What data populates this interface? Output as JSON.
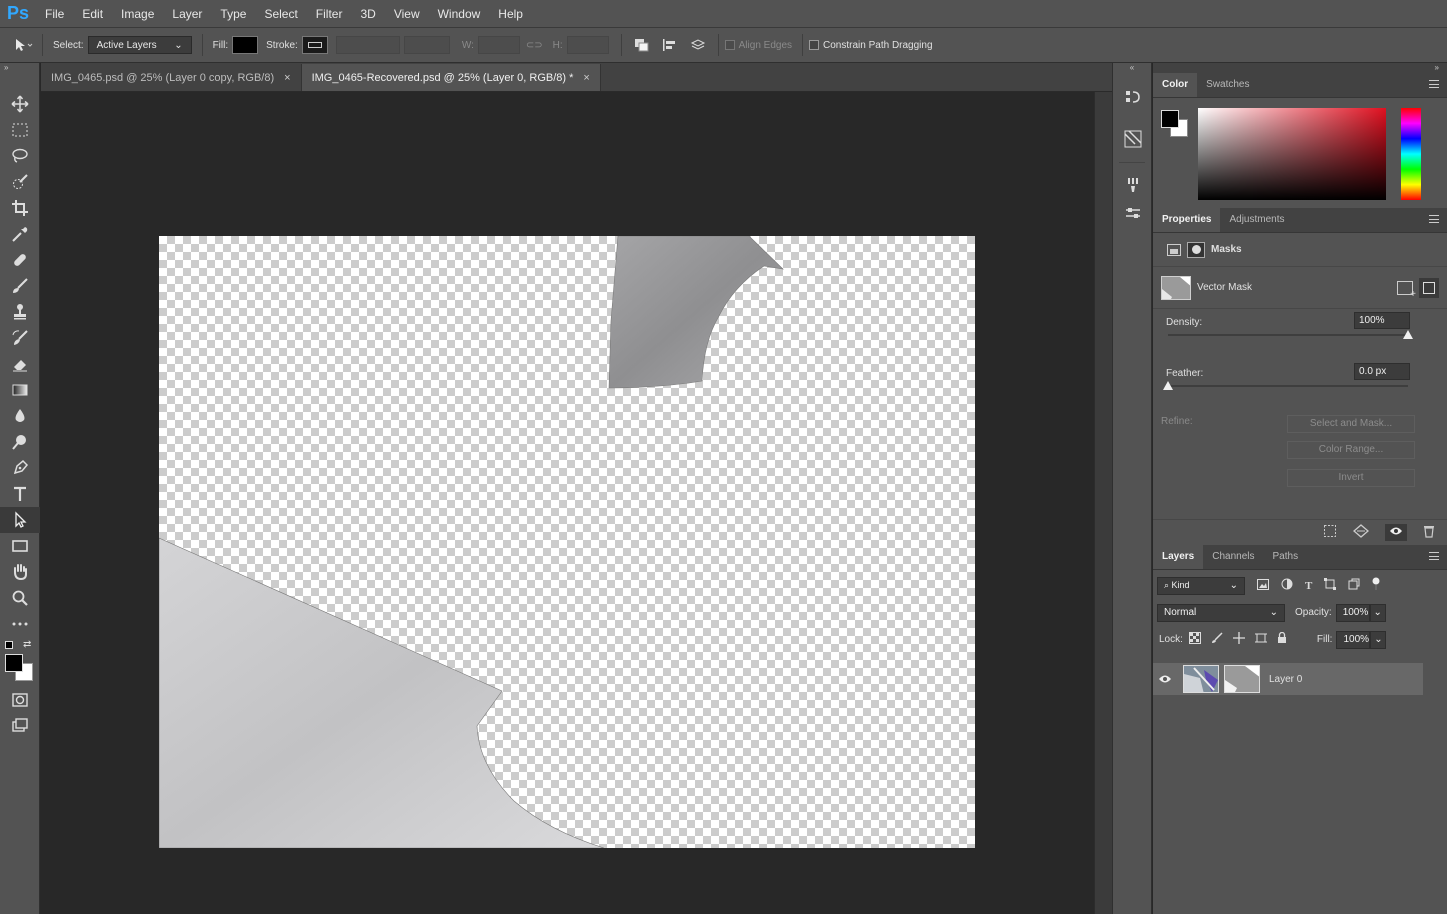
{
  "app": {
    "logo": "Ps"
  },
  "menu": [
    "File",
    "Edit",
    "Image",
    "Layer",
    "Type",
    "Select",
    "Filter",
    "3D",
    "View",
    "Window",
    "Help"
  ],
  "options": {
    "select_label": "Select:",
    "select_value": "Active Layers",
    "fill_label": "Fill:",
    "stroke_label": "Stroke:",
    "w_label": "W:",
    "h_label": "H:",
    "align_edges": "Align Edges",
    "constrain": "Constrain Path Dragging"
  },
  "tabs": [
    {
      "label": "IMG_0465.psd @ 25% (Layer 0 copy, RGB/8)",
      "close": "×"
    },
    {
      "label": "IMG_0465-Recovered.psd @ 25% (Layer 0, RGB/8) *",
      "close": "×"
    }
  ],
  "color_panel": {
    "tabs": [
      "Color",
      "Swatches"
    ]
  },
  "properties_panel": {
    "tabs": [
      "Properties",
      "Adjustments"
    ],
    "masks_label": "Masks",
    "vector_mask": "Vector Mask",
    "density_label": "Density:",
    "density_value": "100%",
    "density": 1.0,
    "feather_label": "Feather:",
    "feather_value": "0.0 px",
    "feather": 0.0,
    "refine_label": "Refine:",
    "select_mask": "Select and Mask...",
    "color_range": "Color Range...",
    "invert": "Invert"
  },
  "layers_panel": {
    "tabs": [
      "Layers",
      "Channels",
      "Paths"
    ],
    "kind": "Kind",
    "blend_mode": "Normal",
    "opacity_label": "Opacity:",
    "opacity_value": "100%",
    "lock_label": "Lock:",
    "fill_label": "Fill:",
    "fill_value": "100%",
    "layer_name": "Layer 0"
  },
  "colors": {
    "accent": "#31a8ff",
    "fg": "#000000",
    "bg": "#ffffff"
  }
}
